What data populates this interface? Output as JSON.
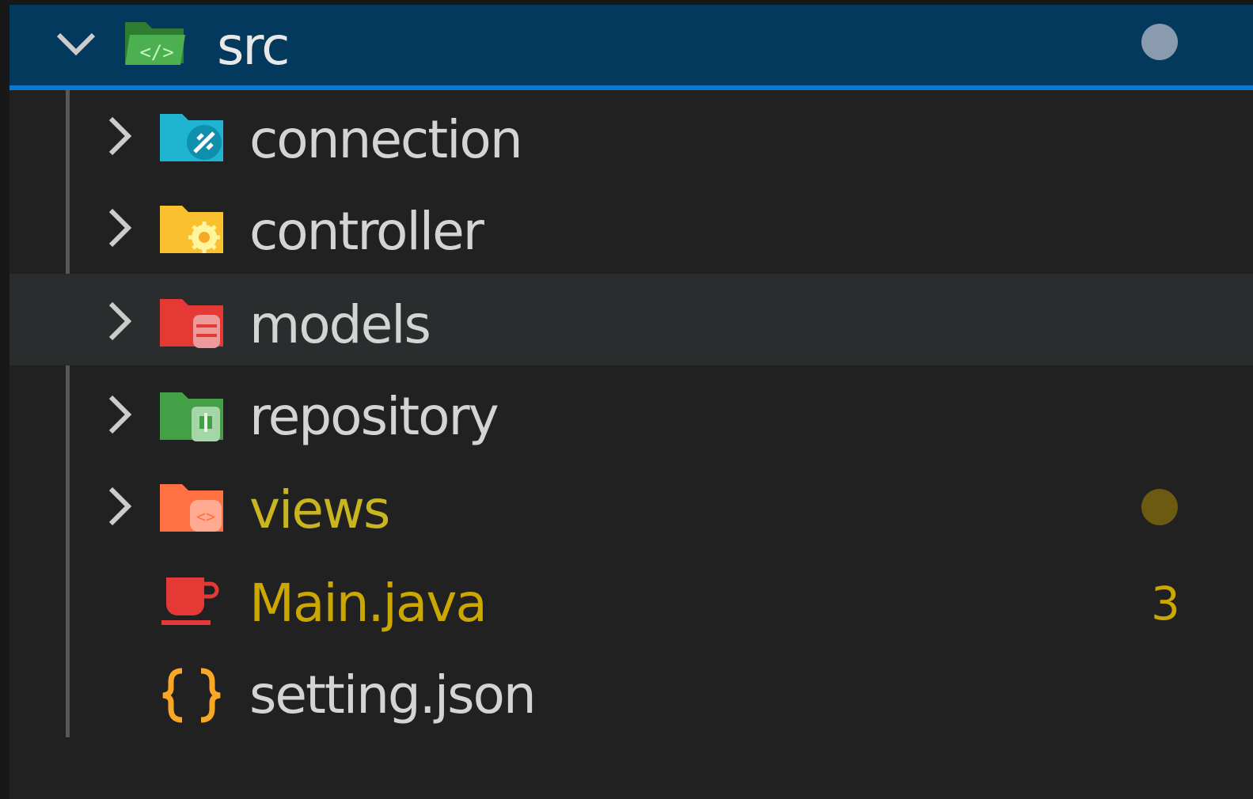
{
  "explorer": {
    "root": {
      "label": "src",
      "icon": "folder-src-open-icon",
      "expanded": true,
      "dot_color": "#8a9bb0"
    },
    "items": [
      {
        "label": "connection",
        "type": "folder",
        "icon": "folder-connection-icon",
        "color": "#1eb4d2"
      },
      {
        "label": "controller",
        "type": "folder",
        "icon": "folder-controller-icon",
        "color": "#fbc02d"
      },
      {
        "label": "models",
        "type": "folder",
        "icon": "folder-models-icon",
        "color": "#e53935",
        "hovered": true
      },
      {
        "label": "repository",
        "type": "folder",
        "icon": "folder-repository-icon",
        "color": "#43a047"
      },
      {
        "label": "views",
        "type": "folder",
        "icon": "folder-views-icon",
        "color": "#ff7043",
        "status": "modified",
        "dot_color": "#6b5a10"
      },
      {
        "label": "Main.java",
        "type": "file",
        "icon": "java-file-icon",
        "color": "#e53935",
        "status": "warning",
        "badge": "3"
      },
      {
        "label": "setting.json",
        "type": "file",
        "icon": "json-file-icon",
        "color": "#f9a825"
      }
    ]
  }
}
